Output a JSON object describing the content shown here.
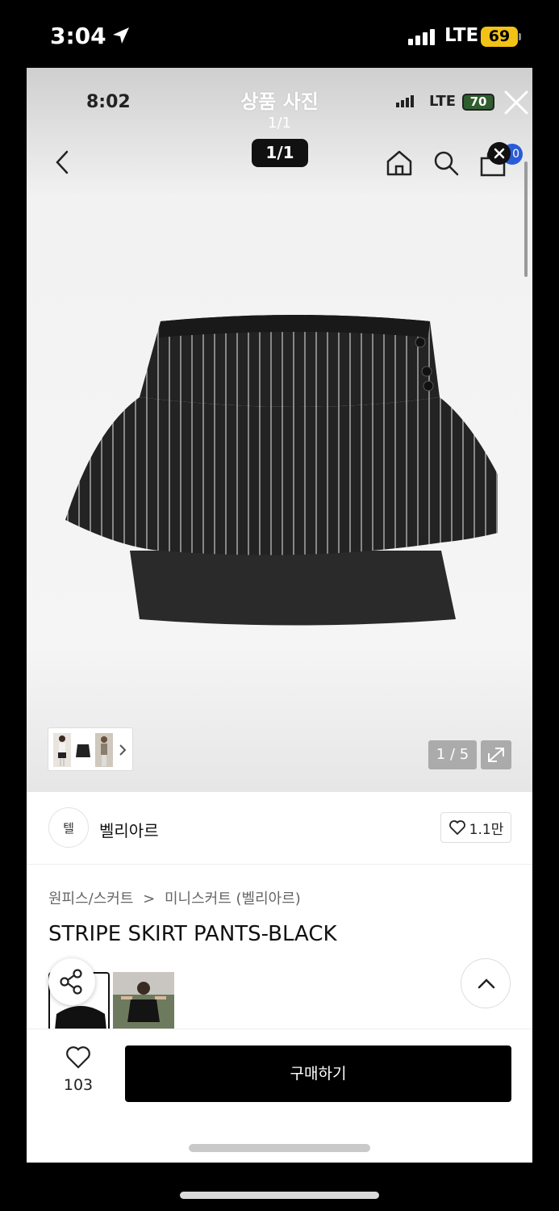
{
  "outer_status": {
    "time": "3:04",
    "network": "LTE",
    "battery": "69"
  },
  "photo_viewer": {
    "inner_time": "8:02",
    "title": "상품 사진",
    "subtitle": "1/1",
    "inner_network": "LTE",
    "inner_battery": "70",
    "counter_pill": "1/1"
  },
  "header": {
    "cart_badge": "0"
  },
  "gallery": {
    "image_counter": "1 / 5"
  },
  "brand": {
    "logo_text": "텔",
    "name": "벨리아르",
    "like_count": "1.1만"
  },
  "product": {
    "breadcrumb_category": "원피스/스커트",
    "breadcrumb_separator": ">",
    "breadcrumb_sub": "미니스커트 (벨리아르)",
    "title": "STRIPE SKIRT PANTS-BLACK"
  },
  "bottom_bar": {
    "wish_count": "103",
    "buy_label": "구매하기"
  },
  "colors": {
    "accent": "#000000",
    "badge": "#2a5bd7",
    "battery_outer": "#f2c315"
  }
}
